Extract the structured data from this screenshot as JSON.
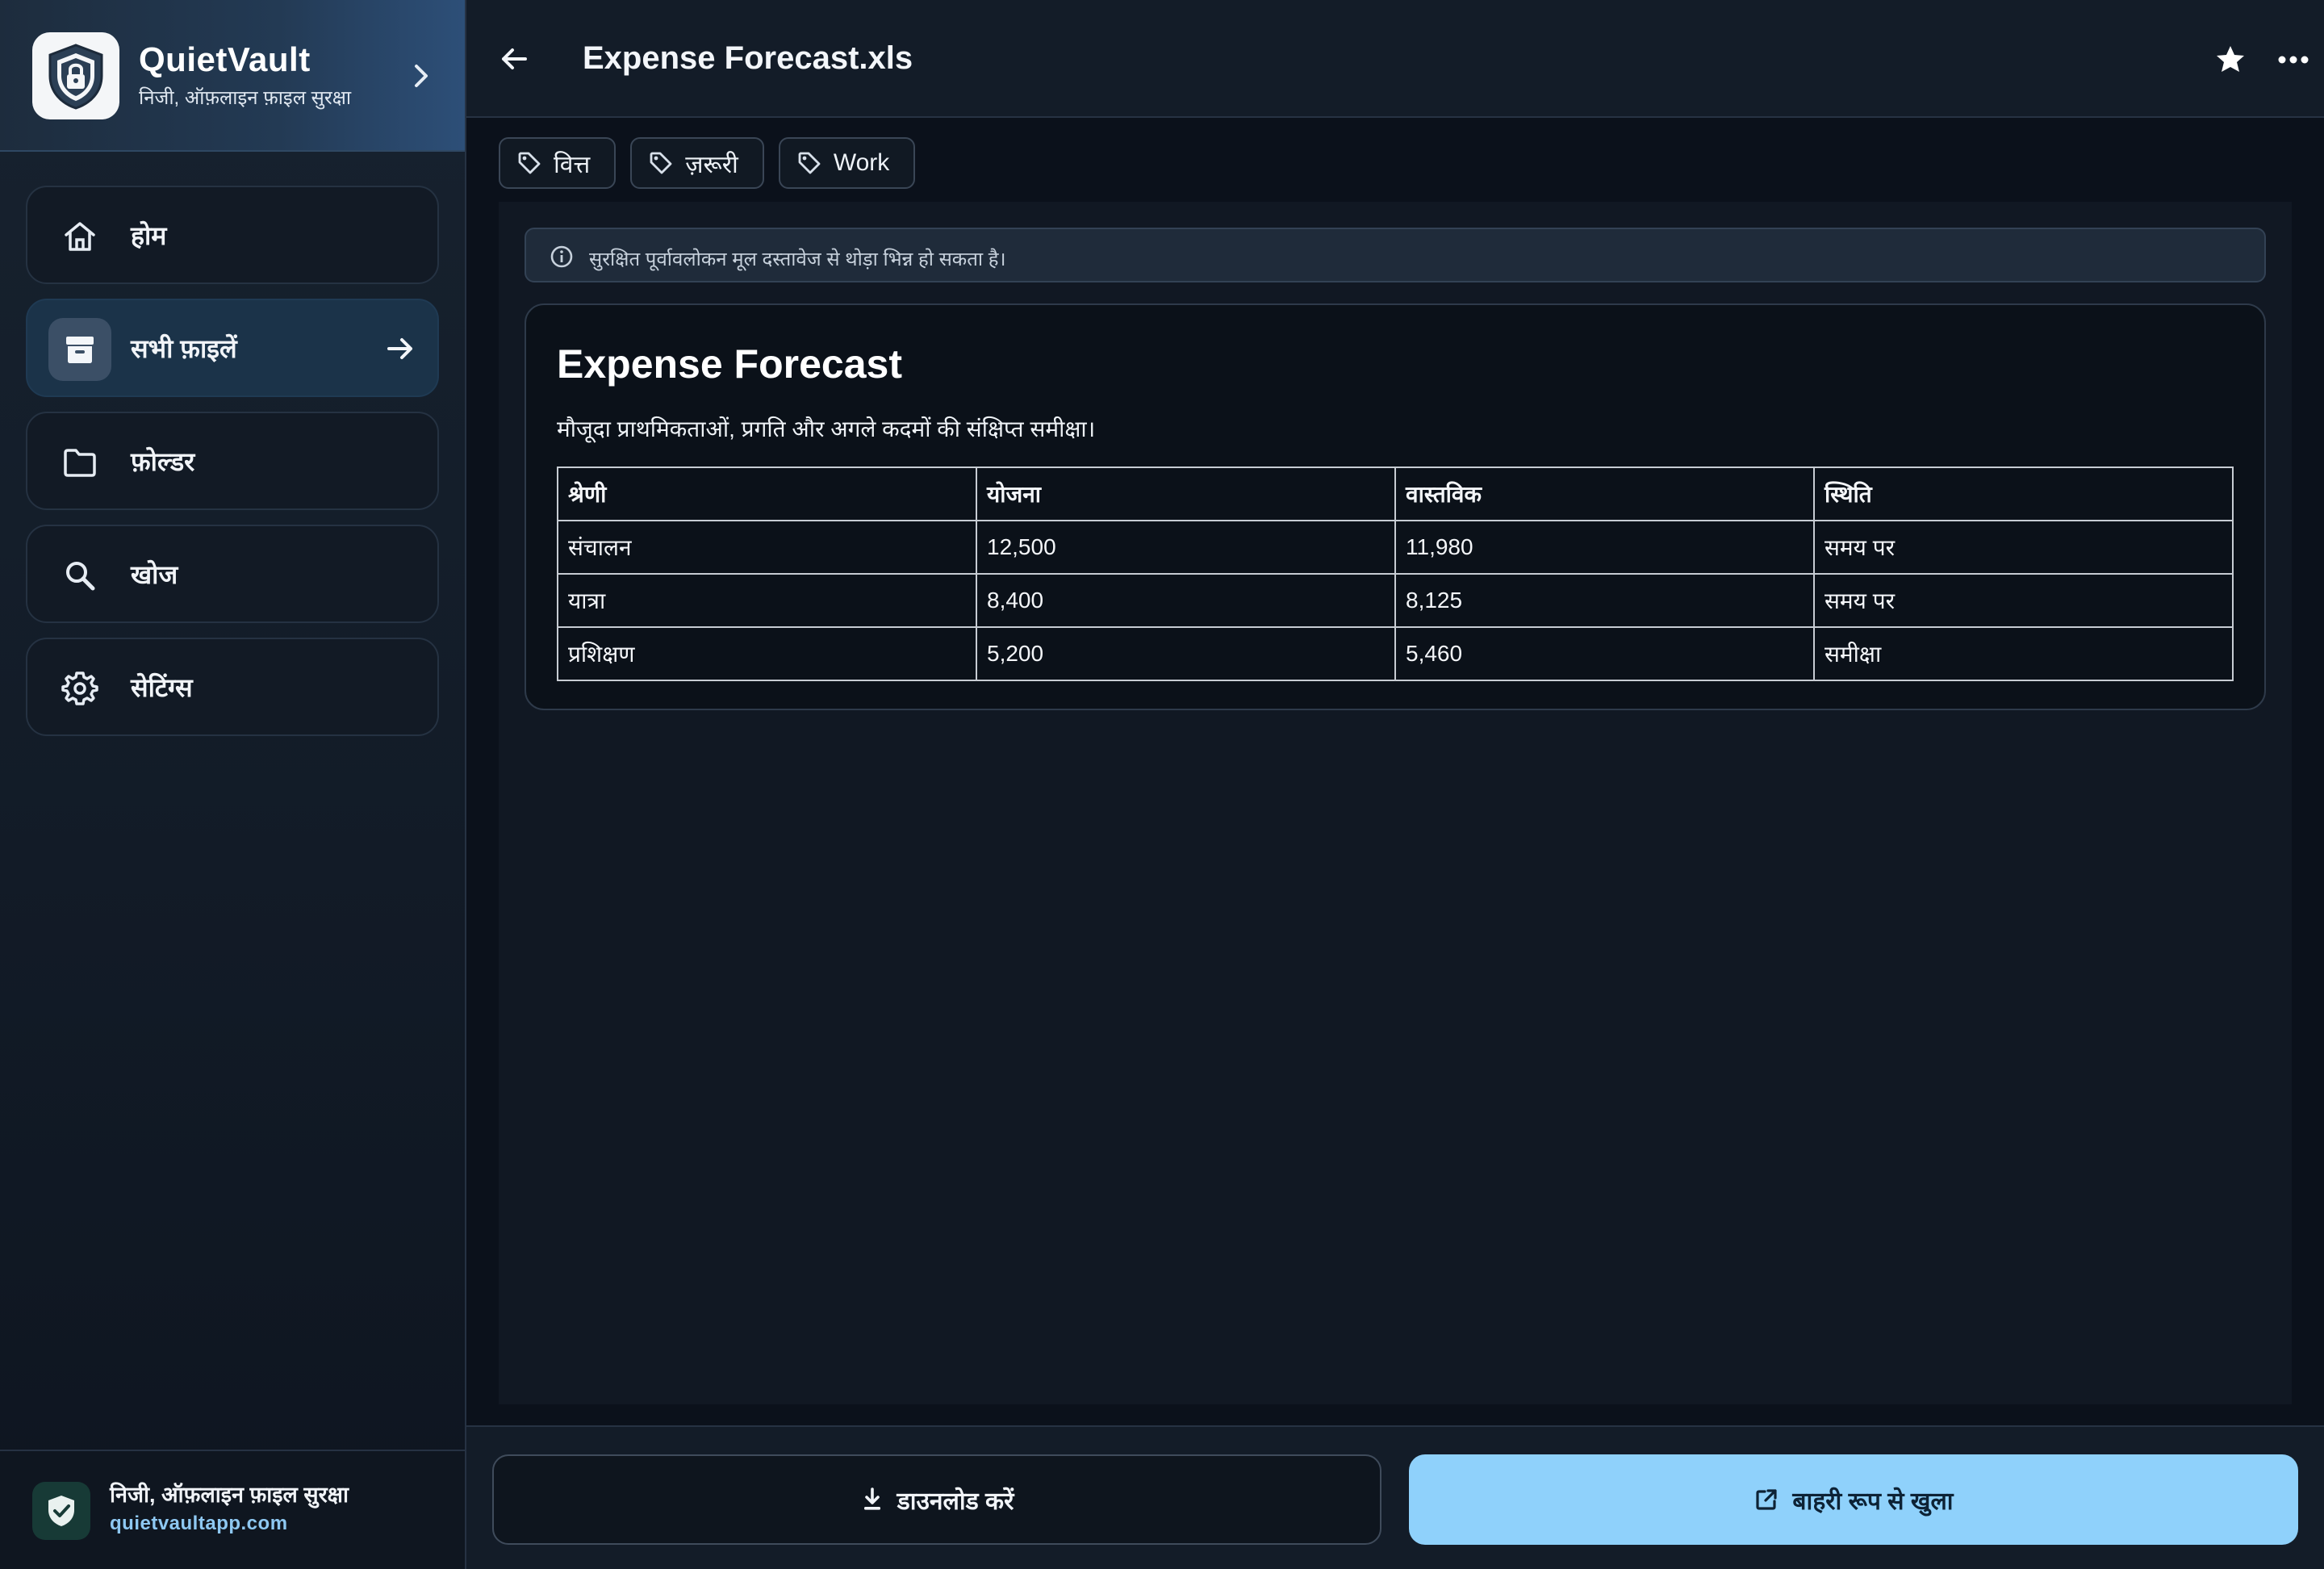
{
  "app": {
    "name": "QuietVault",
    "tagline": "निजी, ऑफ़लाइन फ़ाइल सुरक्षा"
  },
  "sidebar": {
    "items": [
      {
        "label": "होम",
        "icon": "home-icon",
        "active": false
      },
      {
        "label": "सभी फ़ाइलें",
        "icon": "archive-box-icon",
        "active": true
      },
      {
        "label": "फ़ोल्डर",
        "icon": "folder-icon",
        "active": false
      },
      {
        "label": "खोज",
        "icon": "search-icon",
        "active": false
      },
      {
        "label": "सेटिंग्स",
        "icon": "gear-icon",
        "active": false
      }
    ],
    "footer": {
      "title": "निजी, ऑफ़लाइन फ़ाइल सुरक्षा",
      "link": "quietvaultapp.com"
    }
  },
  "header": {
    "file_name": "Expense Forecast.xls"
  },
  "tags": [
    {
      "label": "वित्त"
    },
    {
      "label": "ज़रूरी"
    },
    {
      "label": "Work"
    }
  ],
  "preview": {
    "notice": "सुरक्षित पूर्वावलोकन मूल दस्तावेज से थोड़ा भिन्न हो सकता है।",
    "doc_title": "Expense Forecast",
    "doc_subtitle": "मौजूदा प्राथमिकताओं, प्रगति और अगले कदमों की संक्षिप्त समीक्षा।",
    "table": {
      "headers": [
        "श्रेणी",
        "योजना",
        "वास्तविक",
        "स्थिति"
      ],
      "rows": [
        [
          "संचालन",
          "12,500",
          "11,980",
          "समय पर"
        ],
        [
          "यात्रा",
          "8,400",
          "8,125",
          "समय पर"
        ],
        [
          "प्रशिक्षण",
          "5,200",
          "5,460",
          "समीक्षा"
        ]
      ]
    }
  },
  "actions": {
    "download_label": "डाउनलोड करें",
    "open_external_label": "बाहरी रूप से खुला"
  },
  "colors": {
    "accent": "#8fd1fb",
    "link": "#8ec8f2",
    "active_nav": "#1b3349"
  }
}
